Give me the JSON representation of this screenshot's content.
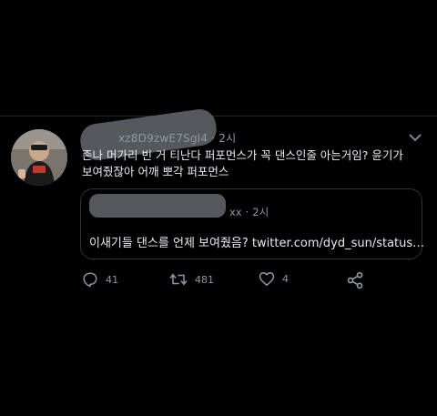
{
  "tweet": {
    "handle_visible": "xz8D9zwE7SgI4",
    "time": "2시",
    "text_line1": "존나 머가리 빈 거 티난다 퍼포먼스가 꼭 댄스인줄 아는거임? 윤기가",
    "text_line2": "보여줬잖아 어깨 뽀각 퍼포먼스"
  },
  "quoted_tweet": {
    "handle_visible": "xx",
    "time": "2시",
    "text": "이새기들 댄스를 언제 보여줬음? twitter.com/dyd_sun/status…"
  },
  "actions": {
    "reply_count": "41",
    "retweet_count": "481",
    "like_count": "4"
  },
  "colors": {
    "background": "#000000",
    "text": "#e6ecf0",
    "muted": "#8899a6",
    "border": "#2f3336"
  },
  "icons": [
    "reply-icon",
    "retweet-icon",
    "like-icon",
    "share-icon",
    "chevron-down-icon"
  ]
}
